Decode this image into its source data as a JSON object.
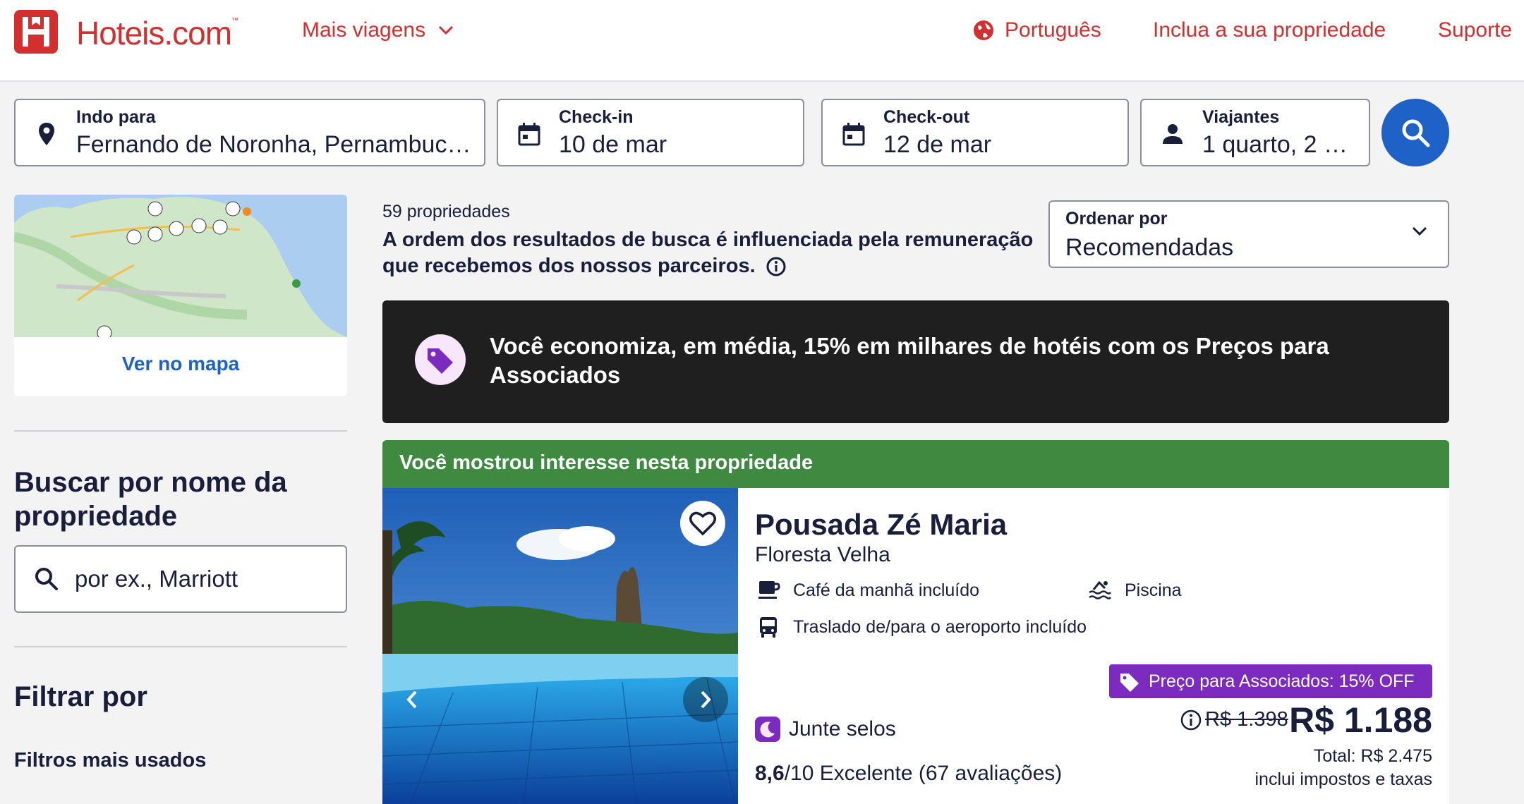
{
  "brand": {
    "name": "Hoteis.com",
    "tm": "™",
    "color": "#d32f2f"
  },
  "nav": {
    "more_trips": "Mais viagens",
    "language": "Português",
    "list_property": "Inclua a sua propriedade",
    "support": "Suporte"
  },
  "search": {
    "destination": {
      "label": "Indo para",
      "value": "Fernando de Noronha, Pernambuco ..."
    },
    "checkin": {
      "label": "Check-in",
      "value": "10 de mar"
    },
    "checkout": {
      "label": "Check-out",
      "value": "12 de mar"
    },
    "travelers": {
      "label": "Viajantes",
      "value": "1 quarto, 2 vi..."
    },
    "button_color": "#1e62c7"
  },
  "map": {
    "link": "Ver no mapa"
  },
  "sidebar": {
    "name_search_title": "Buscar por nome da propriedade",
    "name_search_placeholder": "por ex., Marriott",
    "filter_title": "Filtrar por",
    "popular_filters": "Filtros mais usados"
  },
  "results": {
    "count": "59 propriedades",
    "disclaimer": "A ordem dos resultados de busca é influenciada pela remuneração que recebemos dos nossos parceiros.",
    "sort": {
      "label": "Ordenar por",
      "value": "Recomendadas"
    }
  },
  "banner": {
    "text": "Você economiza, em média, 15% em milhares de hotéis com os Preços para Associados"
  },
  "card": {
    "header": "Você mostrou interesse nesta propriedade",
    "header_color": "#3d8a40",
    "name": "Pousada Zé Maria",
    "location": "Floresta Velha",
    "amenities": [
      "Café da manhã incluído",
      "Piscina",
      "Traslado de/para o aeroporto incluído"
    ],
    "deal_badge": "Preço para Associados: 15% OFF",
    "collect": "Junte selos",
    "old_price": "R$ 1.398",
    "price": "R$ 1.188",
    "total": "Total: R$ 2.475",
    "taxes": "inclui impostos e taxas",
    "rating_score": "8,6",
    "rating_text": "/10 Excelente (67 avaliações)"
  }
}
